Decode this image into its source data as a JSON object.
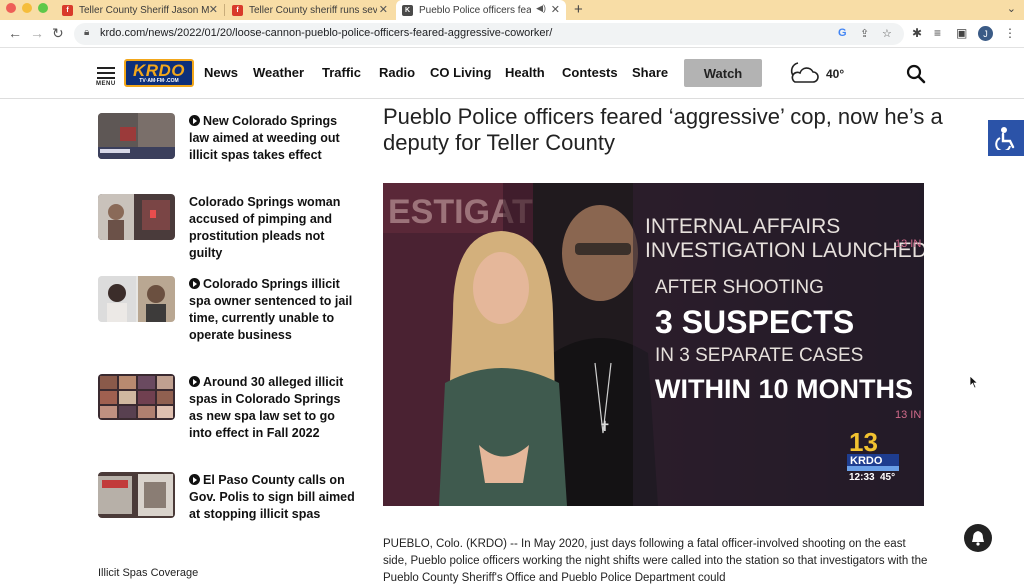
{
  "tabs": [
    {
      "title": "Teller County Sheriff Jason Mik",
      "favicon_color": "#d93a2b",
      "favicon_letter": "f"
    },
    {
      "title": "Teller County sheriff runs seve",
      "favicon_color": "#d93a2b",
      "favicon_letter": "f"
    },
    {
      "title": "Pueblo Police officers feare",
      "favicon_color": "#4a4a4a",
      "favicon_letter": "K"
    }
  ],
  "address_bar": {
    "url": "krdo.com/news/2022/01/20/loose-cannon-pueblo-police-officers-feared-aggressive-coworker/"
  },
  "profile": {
    "initial": "J"
  },
  "site": {
    "logo": {
      "text": "KRDO",
      "sub": "TV·AM·FM·.COM"
    },
    "menu_label": "MENU",
    "nav": [
      "News",
      "Weather",
      "Traffic",
      "Radio",
      "CO Living",
      "Health",
      "Contests",
      "Share"
    ],
    "watch_label": "Watch",
    "temperature": "40°"
  },
  "sidebar": {
    "stories": [
      {
        "title": "New Colorado Springs law aimed at weeding out illicit spas takes effect",
        "video": true
      },
      {
        "title": "Colorado Springs woman accused of pimping and prostitution pleads not guilty",
        "video": false
      },
      {
        "title": "Colorado Springs illicit spa owner sentenced to jail time, currently unable to operate business",
        "video": true
      },
      {
        "title": "Around 30 alleged illicit spas in Colorado Springs as new spa law set to go into effect in Fall 2022",
        "video": true
      },
      {
        "title": "El Paso County calls on Gov. Polis to sign bill aimed at stopping illicit spas",
        "video": true
      }
    ],
    "section_heading": "Illicit Spas Coverage"
  },
  "article": {
    "headline": "Pueblo Police officers feared ‘aggressive’ cop, now he’s a deputy for Teller County",
    "video": {
      "lines": [
        "INTERNAL AFFAIRS",
        "INVESTIGATION LAUNCHED",
        "AFTER SHOOTING",
        "3 SUSPECTS",
        "IN 3 SEPARATE CASES",
        "WITHIN 10 MONTHS"
      ],
      "bug_channel": "13",
      "bug_station": "KRDO",
      "bug_time": "12:33",
      "bug_temp": "45°",
      "bg_text": "ESTIGAT",
      "side_text": "13 IN"
    },
    "body": "PUEBLO, Colo. (KRDO) -- In May 2020, just days following a fatal officer-involved shooting on the east side, Pueblo police officers working the night shifts were called into the station so that investigators with the Pueblo County Sheriff's Office and Pueblo Police Department could"
  },
  "colors": {
    "tabstrip": "#f8dda6",
    "logo_blue": "#0d2f7a",
    "logo_gold": "#f2a71b",
    "accessibility_blue": "#2b53a8"
  }
}
